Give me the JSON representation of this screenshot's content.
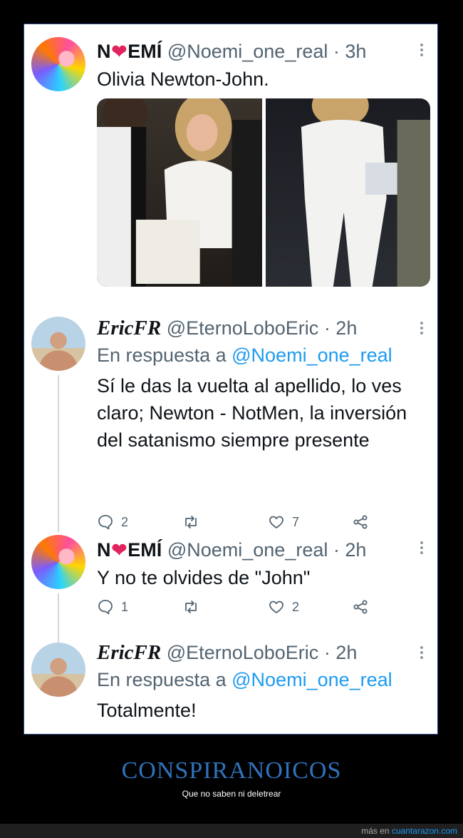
{
  "tweets": [
    {
      "name_pre": "N",
      "name_post": "EMÍ",
      "handle": "@Noemi_one_real",
      "time": "· 3h",
      "text": "Olivia Newton-John."
    },
    {
      "name": "EricFR",
      "handle": "@EternoLoboEric",
      "time": "· 2h",
      "reply_prefix": "En respuesta a",
      "reply_handle": "@Noemi_one_real",
      "text": "Sí le das la vuelta al apellido, lo ves claro; Newton - NotMen, la inversión del satanismo siempre presente",
      "replies": "2",
      "likes": "7"
    },
    {
      "name_pre": "N",
      "name_post": "EMÍ",
      "handle": "@Noemi_one_real",
      "time": "· 2h",
      "text": "Y no te olvides de \"John\"",
      "replies": "1",
      "likes": "2"
    },
    {
      "name": "EricFR",
      "handle": "@EternoLoboEric",
      "time": "· 2h",
      "reply_prefix": "En respuesta a",
      "reply_handle": "@Noemi_one_real",
      "text": "Totalmente!"
    }
  ],
  "caption": {
    "title": "CONSPIRANOICOS",
    "subtitle": "Que no saben ni deletrear"
  },
  "footer": {
    "prefix": "más en",
    "site": "cuantarazon.com"
  },
  "icons": [
    "reply-icon",
    "retweet-icon",
    "like-icon",
    "share-icon",
    "more-icon",
    "heart-emoji-icon"
  ],
  "colors": {
    "link": "#1d9bf0",
    "caption": "#2f73bd",
    "background": "#000000"
  }
}
